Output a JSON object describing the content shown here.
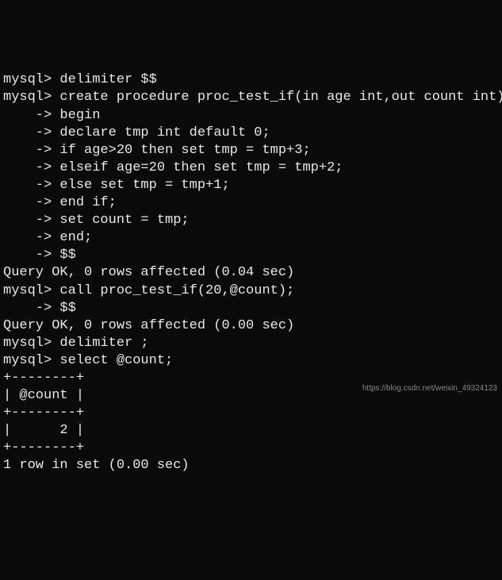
{
  "lines": [
    "mysql> delimiter $$",
    "mysql> create procedure proc_test_if(in age int,out count int)",
    "    -> begin",
    "    -> declare tmp int default 0;",
    "    -> if age>20 then set tmp = tmp+3;",
    "    -> elseif age=20 then set tmp = tmp+2;",
    "    -> else set tmp = tmp+1;",
    "    -> end if;",
    "    -> set count = tmp;",
    "    -> end;",
    "    -> $$",
    "Query OK, 0 rows affected (0.04 sec)",
    "",
    "mysql> call proc_test_if(20,@count);",
    "    -> $$",
    "Query OK, 0 rows affected (0.00 sec)",
    "",
    "mysql> delimiter ;",
    "mysql> select @count;",
    "+--------+",
    "| @count |",
    "+--------+",
    "|      2 |",
    "+--------+",
    "1 row in set (0.00 sec)"
  ],
  "watermark": "https://blog.csdn.net/weixin_49324123"
}
